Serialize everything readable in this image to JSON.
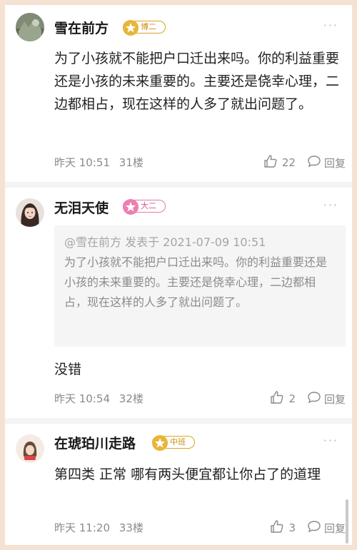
{
  "comments": [
    {
      "username": "雪在前方",
      "badge": "博二",
      "text": "为了小孩就不能把户口迁出来吗。你的利益重要还是小孩的未来重要的。主要还是侥幸心理，二边都相占，现在这样的人多了就出问题了。",
      "time": "昨天 10:51",
      "floor": "31楼",
      "likes": "22",
      "reply_label": "回复",
      "more": "···"
    },
    {
      "username": "无泪天使",
      "badge": "大二",
      "quote_head": "@雪在前方 发表于 2021-07-09 10:51",
      "quote_body": "为了小孩就不能把户口迁出来吗。你的利益重要还是小孩的未来重要的。主要还是侥幸心理，二边都相占，现在这样的人多了就出问题了。",
      "text": "没错",
      "time": "昨天 10:54",
      "floor": "32楼",
      "likes": "2",
      "reply_label": "回复",
      "more": "···"
    },
    {
      "username": "在琥珀川走路",
      "badge": "中班",
      "text": "第四类 正常 哪有两头便宜都让你占了的道理",
      "time": "昨天 11:20",
      "floor": "33楼",
      "likes": "3",
      "reply_label": "回复",
      "more": "···"
    }
  ],
  "colors": {
    "frame": "#f6e2d3",
    "badge_gold": "#e8b53a",
    "badge_pink": "#ec7fb0"
  },
  "icons": [
    "thumbs-up-icon",
    "reply-bubble-icon",
    "star-icon",
    "more-icon"
  ]
}
